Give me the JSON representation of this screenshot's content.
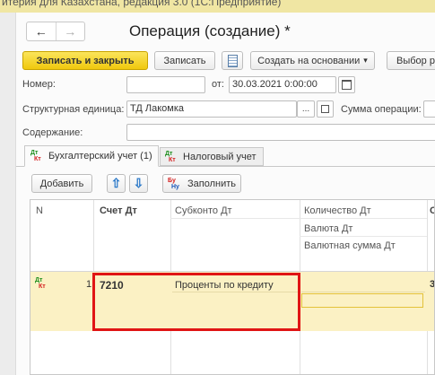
{
  "window": {
    "title_partial": "итерия для Казахстана, редакция 3.0  (1С:Предприятие)"
  },
  "nav": {
    "back": "←",
    "forward": "→"
  },
  "page_title": "Операция (создание) *",
  "toolbar": {
    "save_close": "Записать и закрыть",
    "save": "Записать",
    "create_based": "Создать на основании",
    "create_based_arrow": "▾",
    "select_partial": "Выбор ре"
  },
  "form": {
    "number_label": "Номер:",
    "number_value": "",
    "from_label": "от:",
    "date_value": "30.03.2021  0:00:00",
    "unit_label": "Структурная единица:",
    "unit_value": "ТД Лакомка",
    "dots": "...",
    "sum_label": "Сумма операции:",
    "content_label": "Содержание:",
    "content_value": ""
  },
  "tabs": [
    {
      "label": "Бухгалтерский учет (1)",
      "icon_top": "Дт",
      "icon_bottom": "Кт"
    },
    {
      "label": "Налоговый учет",
      "icon_top": "Дт",
      "icon_bottom": "Кт"
    }
  ],
  "table_toolbar": {
    "add": "Добавить",
    "up": "⇧",
    "down": "⇩",
    "fill": "Заполнить",
    "fill_icon_top": "Бу",
    "fill_icon_bottom": "Ну"
  },
  "table": {
    "headers": {
      "n": "N",
      "account_dt": "Счет Дт",
      "subkonto_dt": "Субконто Дт",
      "qty_dt": "Количество Дт",
      "currency_dt": "Валюта Дт",
      "currency_sum_dt": "Валютная сумма Дт",
      "partial_col": "С"
    },
    "row": {
      "icon_top": "Дт",
      "icon_bottom": "Кт",
      "n": "1",
      "account_dt": "7210",
      "subkonto_dt": "Проценты по кредиту",
      "partial_col": "3"
    }
  }
}
